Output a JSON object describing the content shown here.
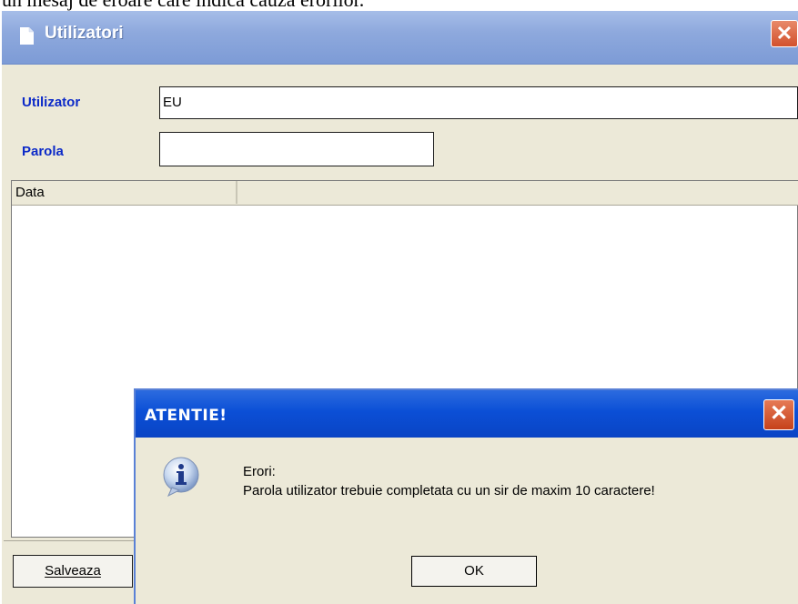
{
  "document": {
    "caption": "un mesaj de eroare care indica cauza erorilor."
  },
  "window": {
    "title": "Utilizatori",
    "close_glyph": "✕",
    "icon": "document-icon"
  },
  "form": {
    "user_label": "Utilizator",
    "user_value": "EU",
    "password_label": "Parola",
    "password_value": ""
  },
  "grid": {
    "columns": [
      "Data",
      ""
    ]
  },
  "footer": {
    "save_label": "Salveaza"
  },
  "dialog": {
    "title": "ATENTIE!",
    "close_glyph": "✕",
    "icon": "info-icon",
    "line1": "Erori:",
    "line2": "Parola utilizator trebuie completata cu un sir de maxim 10 caractere!",
    "ok_label": "OK"
  },
  "colors": {
    "label_blue": "#0c2ac8",
    "dialog_title": "#0b4fd6",
    "window_title": "#8ea9dd",
    "close_red": "#d2512c",
    "face": "#ece9d8"
  }
}
